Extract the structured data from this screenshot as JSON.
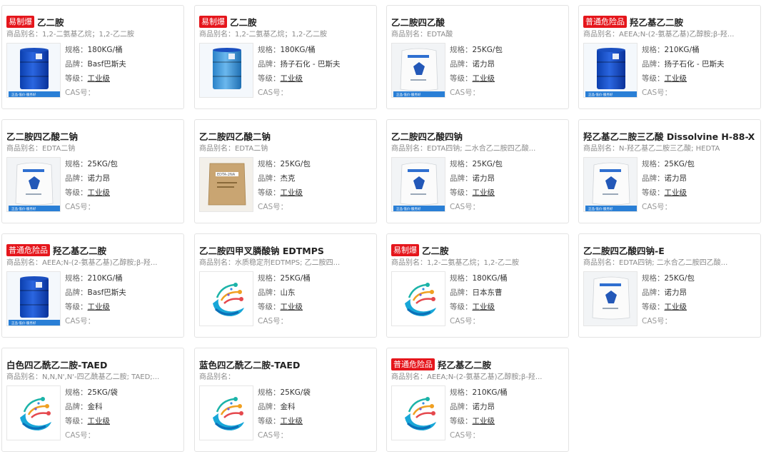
{
  "labels": {
    "alias_prefix": "商品别名：",
    "spec": "规格：",
    "brand": "品牌：",
    "grade": "等级：",
    "cas": "CAS号："
  },
  "products": [
    {
      "badge": "易制爆",
      "title": "乙二胺",
      "alias": "1,2-二氨基乙烷；1,2-乙二胺",
      "spec": "180KG/桶",
      "brand": "Basf巴斯夫",
      "grade": "工业级",
      "cas": "",
      "image": "blue-drum"
    },
    {
      "badge": "易制爆",
      "title": "乙二胺",
      "alias": "1,2-二氨基乙烷；1,2-乙二胺",
      "spec": "180KG/桶",
      "brand": "扬子石化 - 巴斯夫",
      "grade": "工业级",
      "cas": "",
      "image": "lightblue-drum"
    },
    {
      "badge": "",
      "title": "乙二胺四乙酸",
      "alias": "EDTA酸",
      "spec": "25KG/包",
      "brand": "诺力昂",
      "grade": "工业级",
      "cas": "",
      "image": "white-bag"
    },
    {
      "badge": "普通危险品",
      "title": "羟乙基乙二胺",
      "alias": "AEEA;N-(2-氨基乙基)乙醇胺;β-羟...",
      "spec": "210KG/桶",
      "brand": "扬子石化 - 巴斯夫",
      "grade": "工业级",
      "cas": "",
      "image": "blue-drum"
    },
    {
      "badge": "",
      "title": "乙二胺四乙酸二钠",
      "alias": "EDTA二钠",
      "spec": "25KG/包",
      "brand": "诺力昂",
      "grade": "工业级",
      "cas": "",
      "image": "white-bag"
    },
    {
      "badge": "",
      "title": "乙二胺四乙酸二钠",
      "alias": "EDTA二钠",
      "spec": "25KG/包",
      "brand": "杰克",
      "grade": "工业级",
      "cas": "",
      "image": "kraft-bag"
    },
    {
      "badge": "",
      "title": "乙二胺四乙酸四钠",
      "alias": "EDTA四钠; 二水合乙二胺四乙酸...",
      "spec": "25KG/包",
      "brand": "诺力昂",
      "grade": "工业级",
      "cas": "",
      "image": "white-bag"
    },
    {
      "badge": "",
      "title": "羟乙基乙二胺三乙酸 Dissolvine H-88-X",
      "alias": "N-羟乙基乙二胺三乙酸; HEDTA",
      "spec": "25KG/包",
      "brand": "诺力昂",
      "grade": "工业级",
      "cas": "",
      "image": "white-bag"
    },
    {
      "badge": "普通危险品",
      "title": "羟乙基乙二胺",
      "alias": "AEEA;N-(2-氨基乙基)乙醇胺;β-羟...",
      "spec": "210KG/桶",
      "brand": "Basf巴斯夫",
      "grade": "工业级",
      "cas": "",
      "image": "blue-drum"
    },
    {
      "badge": "",
      "title": "乙二胺四甲叉膦酸钠 EDTMPS",
      "alias": "水质稳定剂EDTMPS; 乙二胺四...",
      "spec": "25KG/桶",
      "brand": "山东",
      "grade": "工业级",
      "cas": "",
      "image": "logo"
    },
    {
      "badge": "易制爆",
      "title": "乙二胺",
      "alias": "1,2-二氨基乙烷；1,2-乙二胺",
      "spec": "180KG/桶",
      "brand": "日本东曹",
      "grade": "工业级",
      "cas": "",
      "image": "logo"
    },
    {
      "badge": "",
      "title": "乙二胺四乙酸四钠-E",
      "alias": "EDTA四钠; 二水合乙二胺四乙酸...",
      "spec": "25KG/包",
      "brand": "诺力昂",
      "grade": "工业级",
      "cas": "",
      "image": "white-sack"
    },
    {
      "badge": "",
      "title": "白色四乙酰乙二胺-TAED",
      "alias": "N,N,N',N'-四乙酰基乙二胺; TAED;...",
      "spec": "25KG/袋",
      "brand": "金科",
      "grade": "工业级",
      "cas": "",
      "image": "logo"
    },
    {
      "badge": "",
      "title": "蓝色四乙酰乙二胺-TAED",
      "alias": "",
      "spec": "25KG/袋",
      "brand": "金科",
      "grade": "工业级",
      "cas": "",
      "image": "logo"
    },
    {
      "badge": "普通危险品",
      "title": "羟乙基乙二胺",
      "alias": "AEEA;N-(2-氨基乙基)乙醇胺;β-羟...",
      "spec": "210KG/桶",
      "brand": "诺力昂",
      "grade": "工业级",
      "cas": "",
      "image": "logo"
    }
  ],
  "footer_strip_text": "正品·低价·服务好"
}
